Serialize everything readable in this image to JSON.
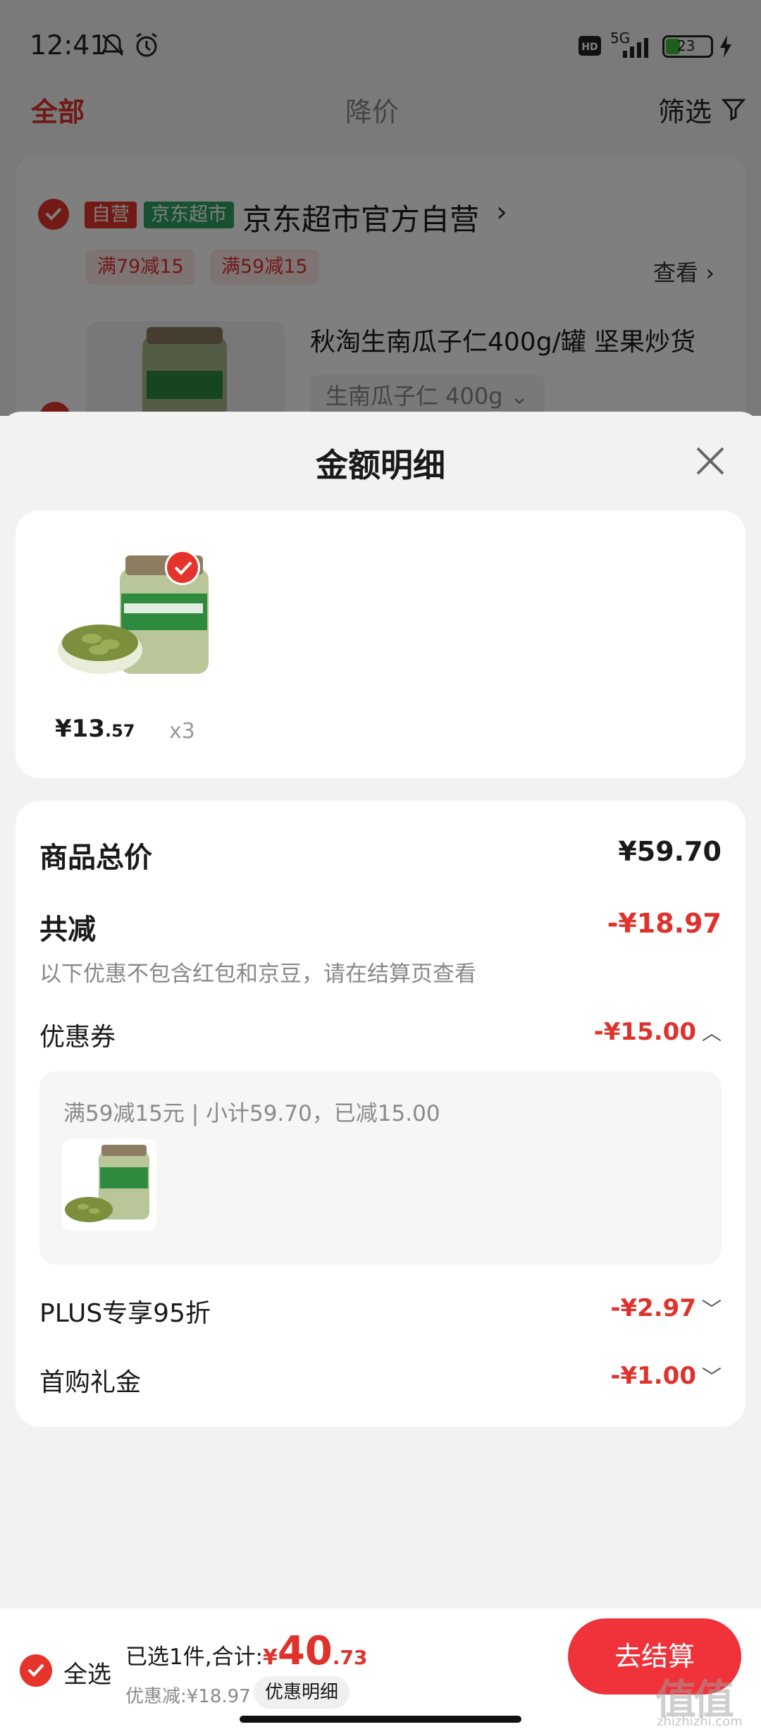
{
  "status_bar": {
    "time": "12:41",
    "network": "5G",
    "battery": "23"
  },
  "tabs": {
    "all": "全部",
    "price_drop": "降价",
    "filter": "筛选"
  },
  "store": {
    "tag_self": "自营",
    "tag_supermarket": "京东超市",
    "name": "京东超市官方自营",
    "promos": [
      "满79减15",
      "满59减15"
    ],
    "view_label": "查看"
  },
  "bg_product": {
    "title": "秋淘生南瓜子仁400g/罐 坚果炒货",
    "spec": "生南瓜子仁 400g"
  },
  "sheet": {
    "title": "金额明细",
    "product": {
      "price_main": "¥13",
      "price_cents": ".57",
      "qty": "x3"
    },
    "total_label": "商品总价",
    "total_value": "¥59.70",
    "reduce_label": "共减",
    "reduce_value": "-¥18.97",
    "note": "以下优惠不包含红包和京豆，请在结算页查看",
    "coupon_label": "优惠券",
    "coupon_value": "-¥15.00",
    "coupon_desc": "满59减15元 | 小计59.70，已减15.00",
    "plus_label": "PLUS专享95折",
    "plus_value": "-¥2.97",
    "gift_label": "首购礼金",
    "gift_value": "-¥1.00"
  },
  "bottom": {
    "select_all": "全选",
    "summary_prefix": "已选1件,合计:",
    "yen": "¥",
    "total_big": "40",
    "total_small": ".73",
    "discount": "优惠减:¥18.97",
    "detail_btn": "优惠明细",
    "checkout": "去结算"
  },
  "watermark": {
    "main": "值值值",
    "sub": "zhizhizhi.com"
  },
  "colors": {
    "accent": "#e4342b",
    "supermarket_green": "#2ea364",
    "checkout": "#f0323a"
  }
}
